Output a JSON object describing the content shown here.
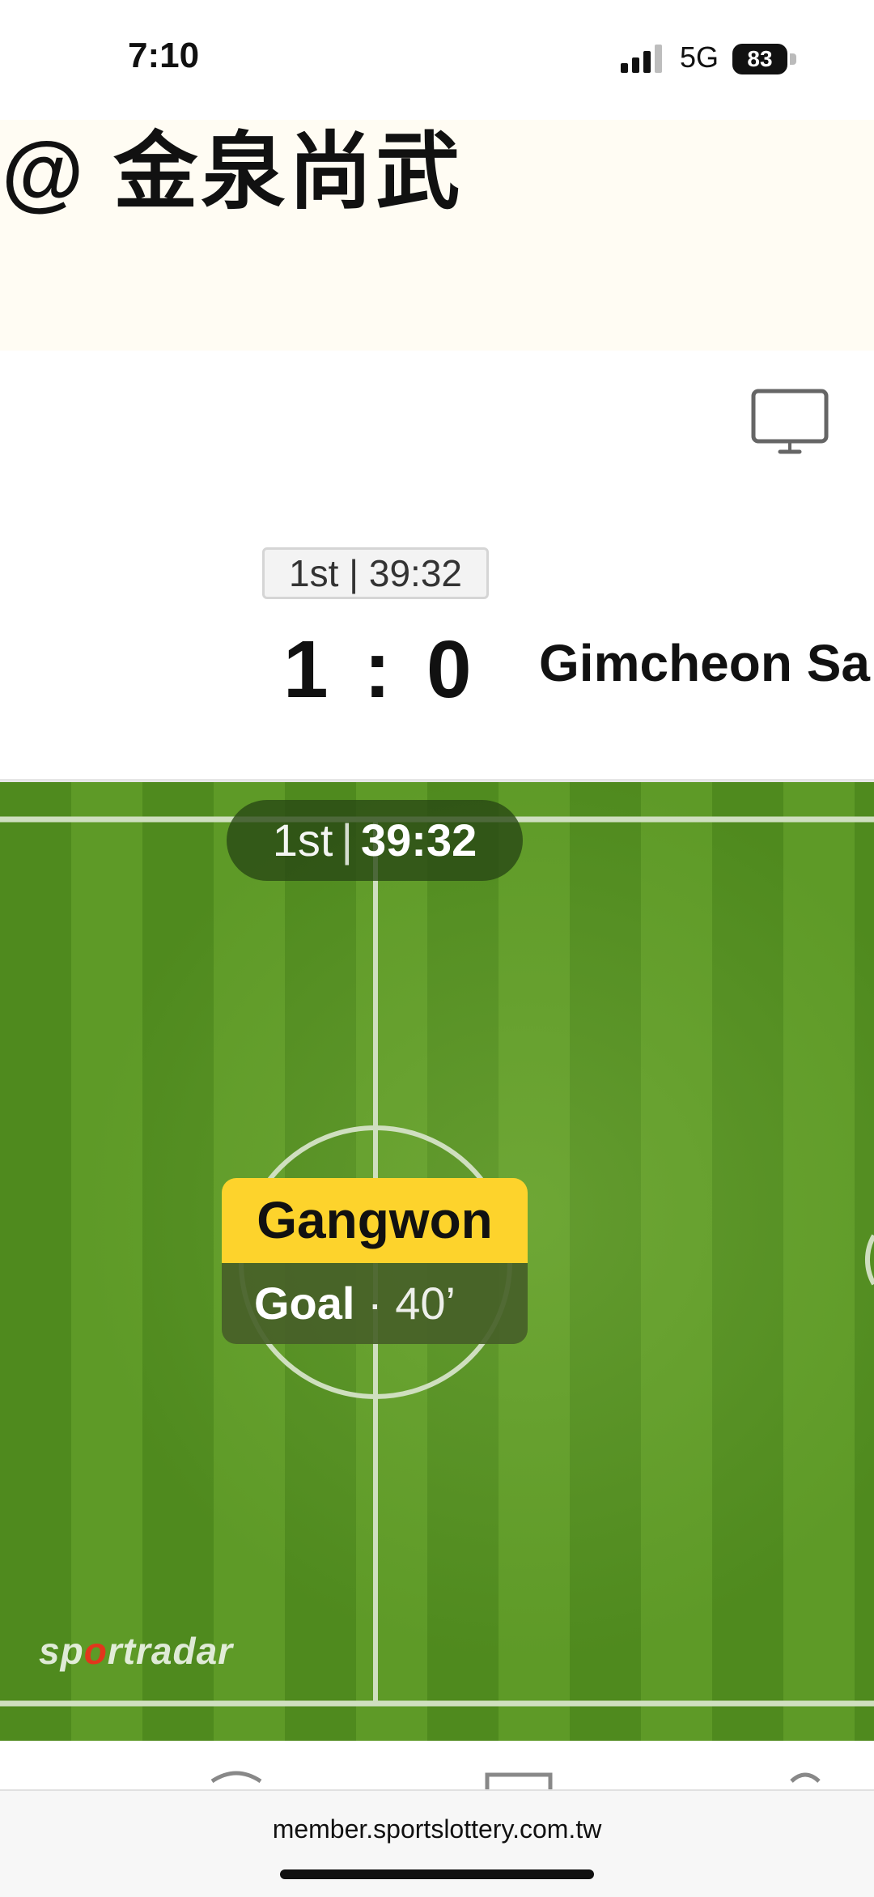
{
  "status_bar": {
    "time": "7:10",
    "network": "5G",
    "battery": "83"
  },
  "header": {
    "match_title": "@ 金泉尚武"
  },
  "scoreboard": {
    "period_time": "1st | 39:32",
    "home_score": "1",
    "separator": ":",
    "away_score": "0",
    "away_team": "Gimcheon Sa"
  },
  "pitch": {
    "clock_period": "1st",
    "clock_divider": "|",
    "clock_time": "39:32",
    "event": {
      "team": "Gangwon",
      "type": "Goal",
      "minute": "· 40’"
    },
    "logo": {
      "part1": "sp",
      "part2": "o",
      "part3": "rtradar"
    }
  },
  "browser": {
    "url": "member.sportslottery.com.tw"
  },
  "colors": {
    "pitch_green": "#4f8a1e",
    "event_yellow": "#fdd32c",
    "title_band": "#fffcf3"
  }
}
